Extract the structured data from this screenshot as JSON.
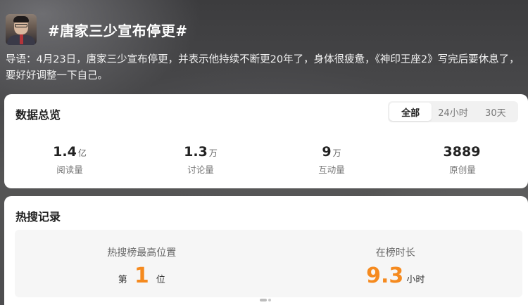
{
  "header": {
    "avatar_icon": "person-avatar",
    "topic_title": "#唐家三少宣布停更#"
  },
  "intro": {
    "text": "导语：4月23日，唐家三少宣布停更，并表示他持续不断更20年了，身体很疲惫，《神印王座2》写完后要休息了，要好好调整一下自己。"
  },
  "overview": {
    "title": "数据总览",
    "tabs": [
      {
        "label": "全部",
        "active": true
      },
      {
        "label": "24小时",
        "active": false
      },
      {
        "label": "30天",
        "active": false
      }
    ],
    "stats": [
      {
        "value": "1.4",
        "unit": "亿",
        "label": "阅读量"
      },
      {
        "value": "1.3",
        "unit": "万",
        "label": "讨论量"
      },
      {
        "value": "9",
        "unit": "万",
        "label": "互动量"
      },
      {
        "value": "3889",
        "unit": "",
        "label": "原创量"
      }
    ]
  },
  "hot": {
    "title": "热搜记录",
    "peak": {
      "label": "热搜榜最高位置",
      "prefix": "第",
      "value": "1",
      "suffix": "位"
    },
    "duration": {
      "label": "在榜时长",
      "value": "9.3",
      "unit": "小时"
    }
  },
  "colors": {
    "accent": "#f58a1f",
    "card_bg": "#ffffff",
    "box_bg": "#f6f6f6"
  }
}
